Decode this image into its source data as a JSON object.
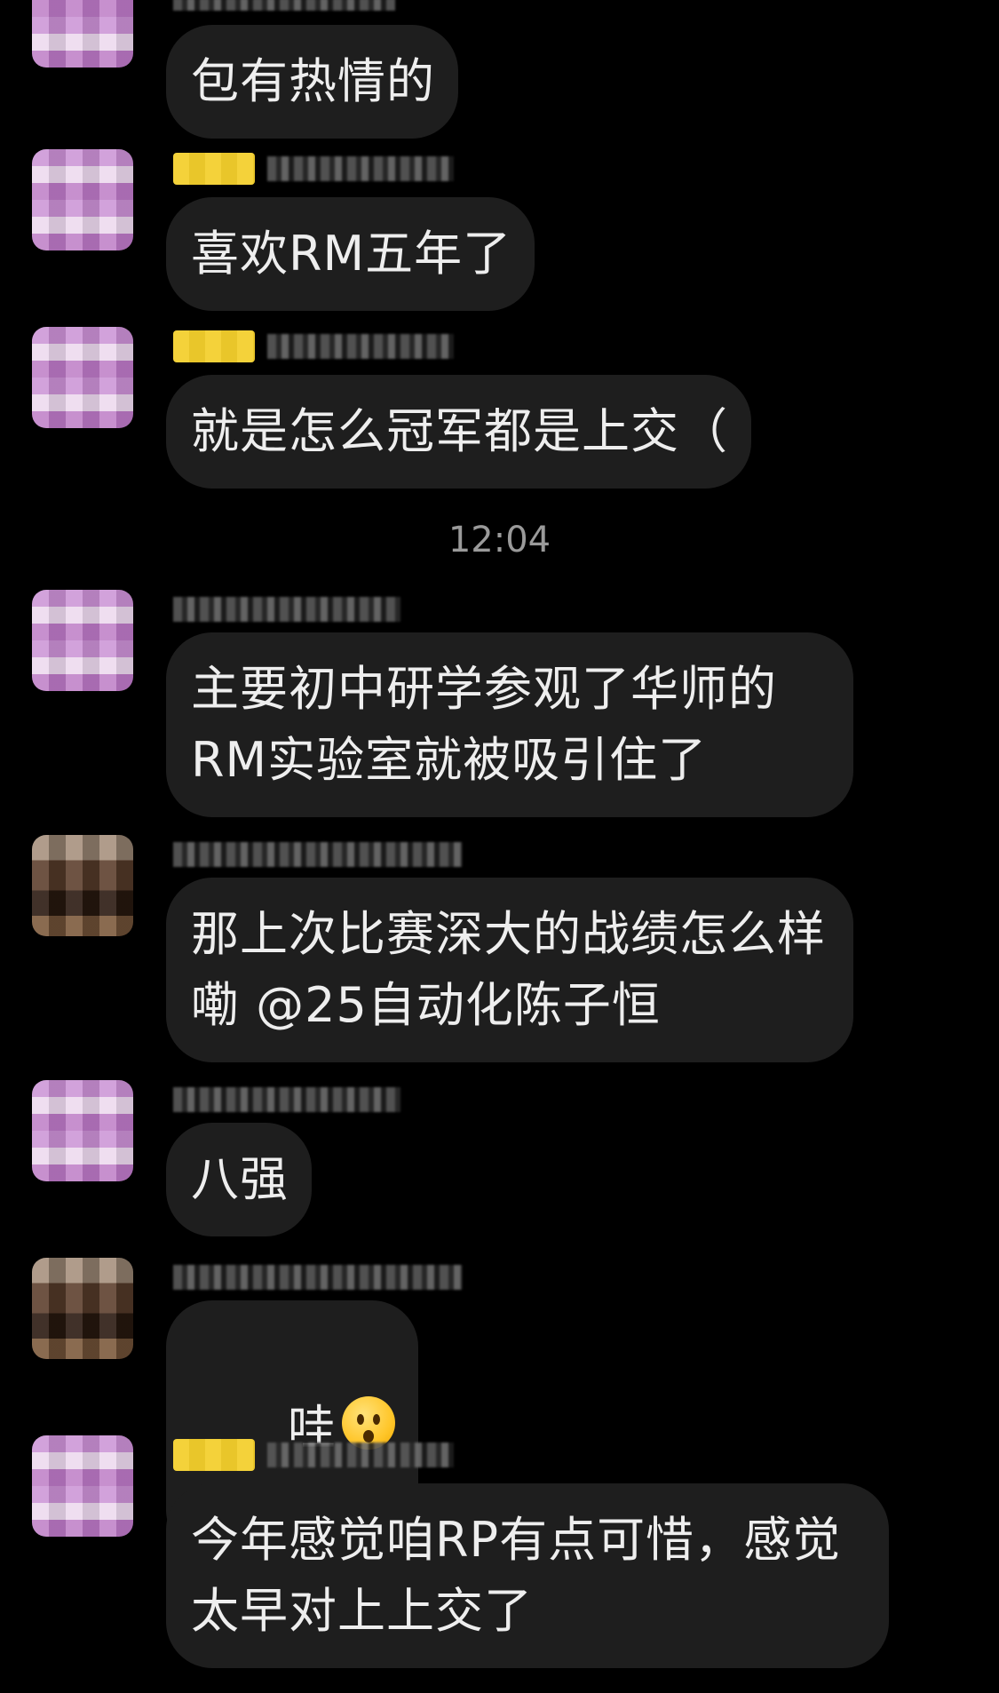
{
  "timestamp": "12:04",
  "messages": [
    {
      "text": "包有热情的"
    },
    {
      "text": "喜欢RM五年了"
    },
    {
      "text": "就是怎么冠军都是上交（"
    },
    {
      "text": "主要初中研学参观了华师的RM实验室就被吸引住了"
    },
    {
      "text": "那上次比赛深大的战绩怎么样嘞 @25自动化陈子恒"
    },
    {
      "text": "八强"
    },
    {
      "text": "哇",
      "emoji": "hushed-face-icon"
    },
    {
      "text": "今年感觉咱RP有点可惜，感觉太早对上上交了"
    }
  ]
}
